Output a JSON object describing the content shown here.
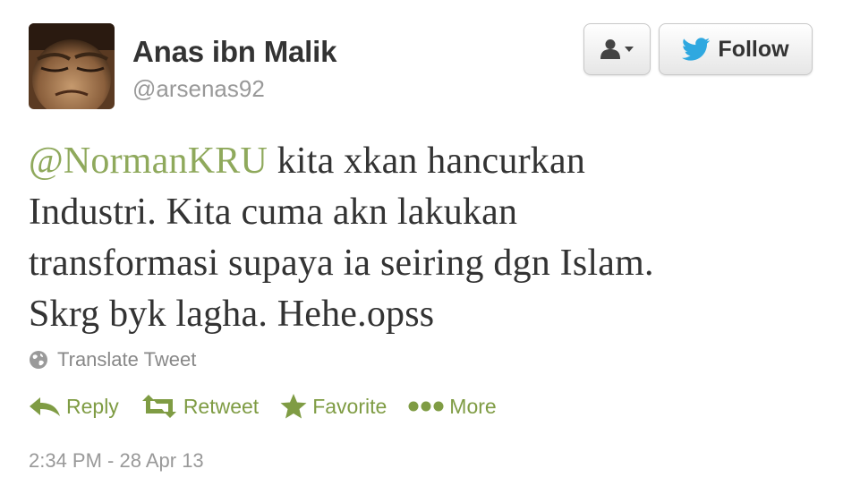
{
  "user": {
    "full_name": "Anas ibn Malik",
    "username": "@arsenas92",
    "avatar_icon": "user-photo"
  },
  "header_buttons": {
    "user_menu_icon": "user-dropdown-icon",
    "follow_label": "Follow"
  },
  "tweet": {
    "mention": "@NormanKRU",
    "line1_rest": " kita xkan hancurkan",
    "line2": "Industri. Kita cuma akn lakukan",
    "line3": "transformasi supaya ia seiring dgn Islam.",
    "line4": "Skrg byk lagha. Hehe.opss"
  },
  "translate": {
    "label": "Translate Tweet"
  },
  "actions": {
    "reply": "Reply",
    "retweet": "Retweet",
    "favorite": "Favorite",
    "more": "More"
  },
  "timestamp": "2:34 PM - 28 Apr 13",
  "colors": {
    "accent_green": "#7f9c44",
    "mention_green": "#8fa95c",
    "text": "#333333",
    "muted": "#999999",
    "twitter_blue": "#2fa8e0"
  }
}
